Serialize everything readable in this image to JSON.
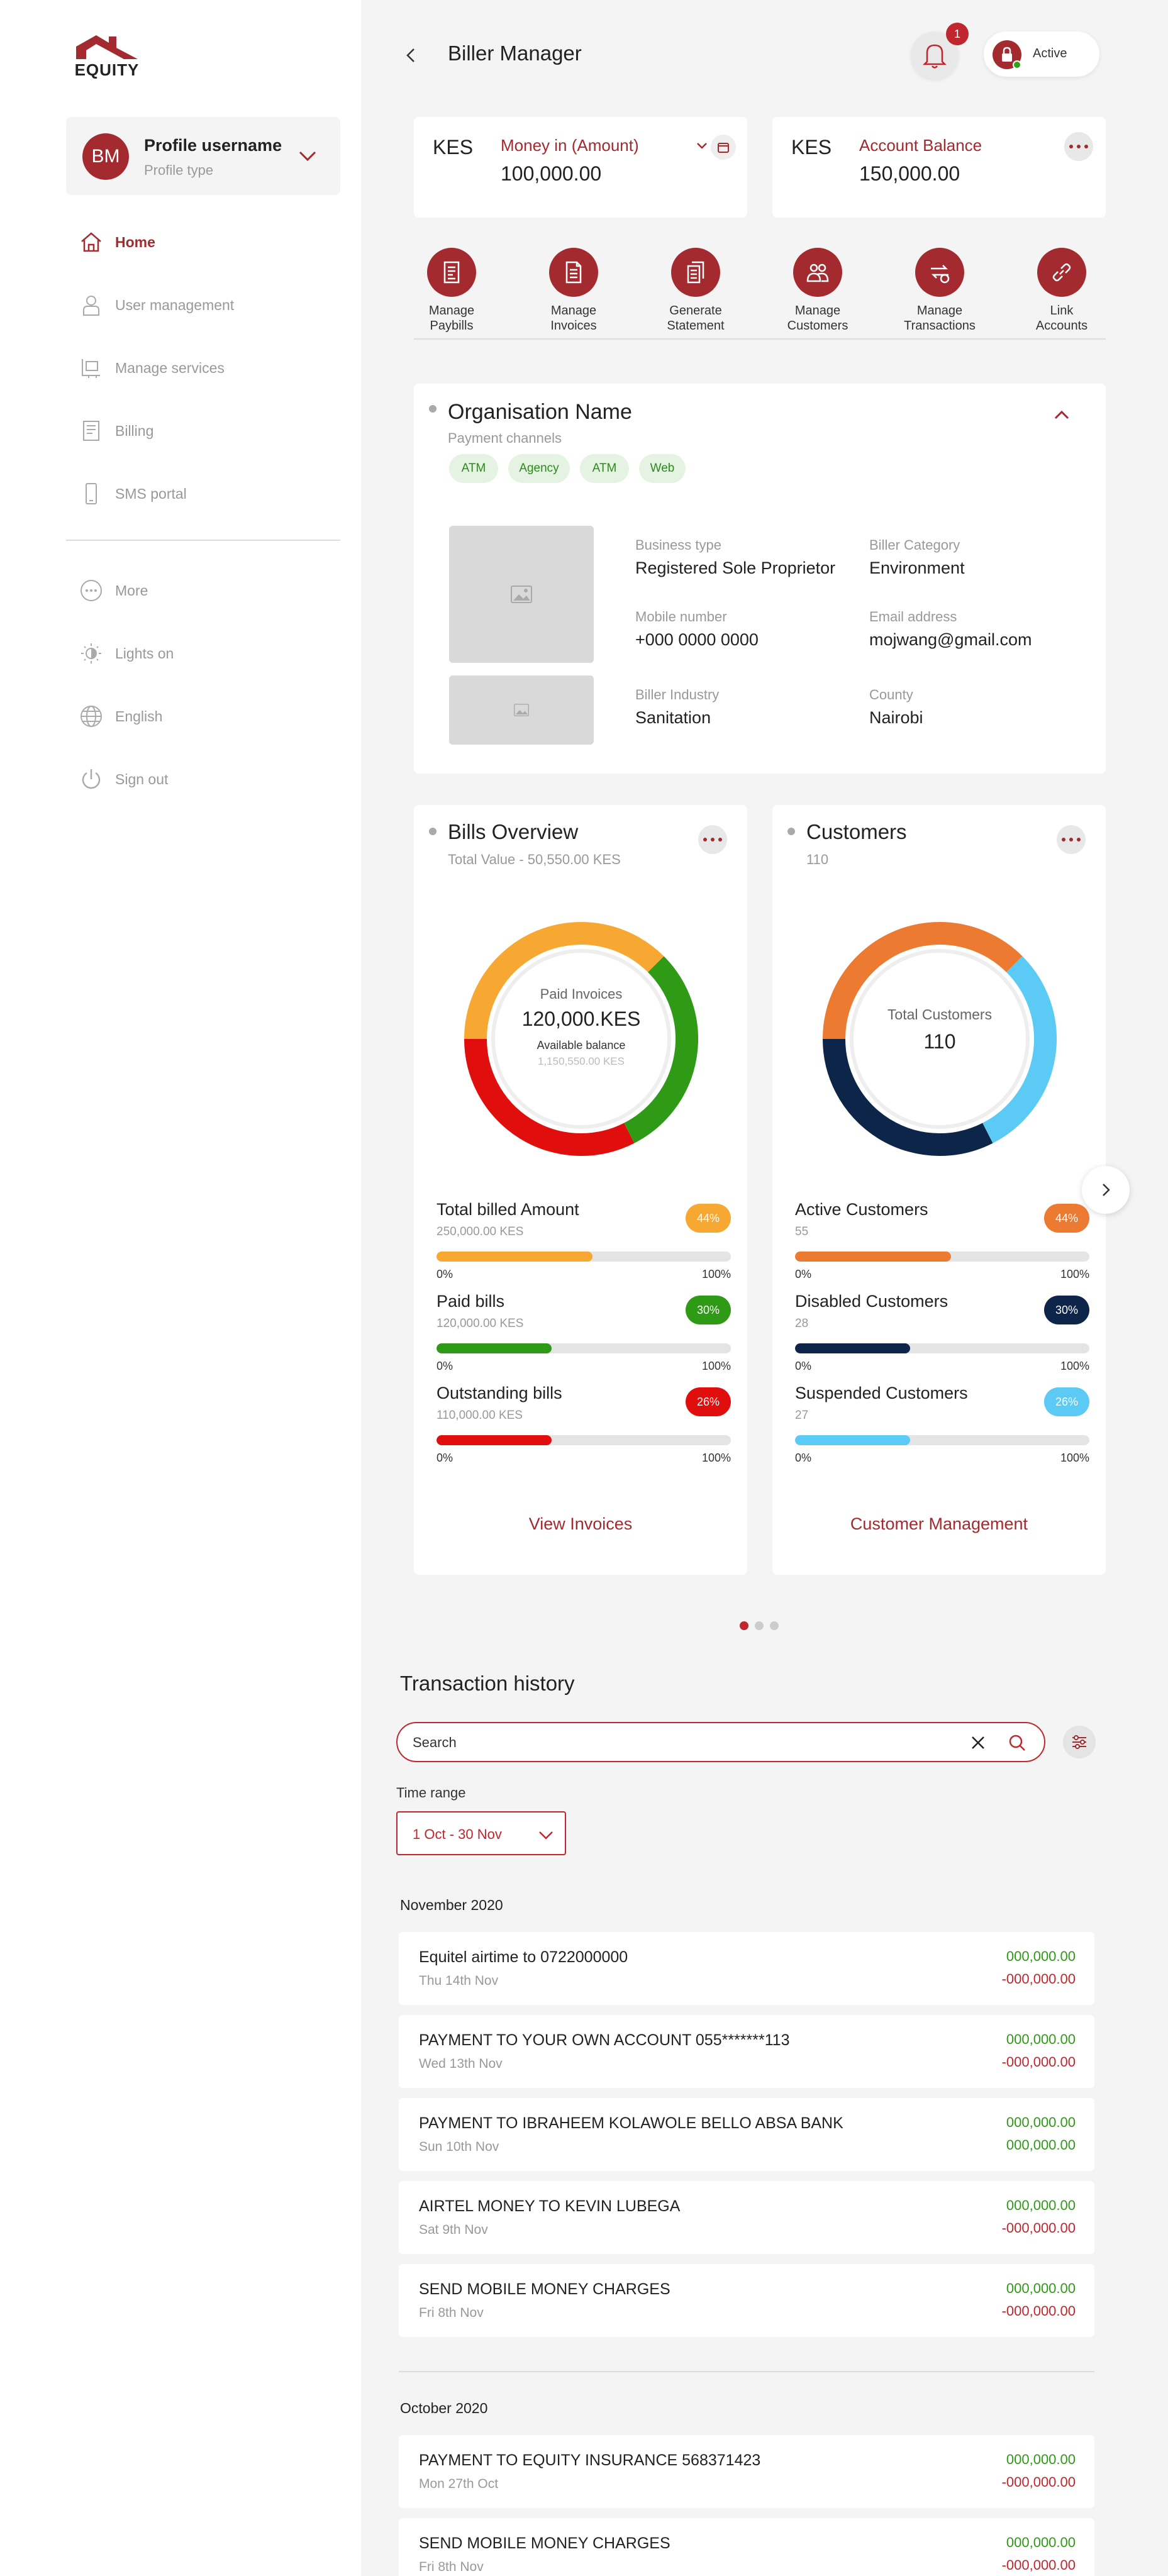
{
  "brand": {
    "name": "EQUITY",
    "accent": "#a32a2e",
    "red": "#c0262d",
    "green": "#2e9a16"
  },
  "profile": {
    "initials": "BM",
    "name": "Profile username",
    "type": "Profile type"
  },
  "nav": {
    "home": "Home",
    "users": "User management",
    "services": "Manage services",
    "billing": "Billing",
    "sms": "SMS portal",
    "more": "More",
    "lights": "Lights on",
    "language": "English",
    "signout": "Sign out"
  },
  "header": {
    "title": "Biller Manager",
    "notifications": "1",
    "status": "Active"
  },
  "money_in": {
    "currency": "KES",
    "label": "Money in (Amount)",
    "value": "100,000.00"
  },
  "balance": {
    "currency": "KES",
    "label": "Account Balance",
    "value": "150,000.00"
  },
  "quick_actions": [
    {
      "l1": "Manage",
      "l2": "Paybills"
    },
    {
      "l1": "Manage",
      "l2": "Invoices"
    },
    {
      "l1": "Generate",
      "l2": "Statement"
    },
    {
      "l1": "Manage",
      "l2": "Customers"
    },
    {
      "l1": "Manage",
      "l2": "Transactions"
    },
    {
      "l1": "Link",
      "l2": "Accounts"
    }
  ],
  "org": {
    "name": "Organisation Name",
    "sub": "Payment channels",
    "chips": [
      "ATM",
      "Agency",
      "ATM",
      "Web"
    ],
    "business_type_label": "Business type",
    "business_type": "Registered Sole Proprietor",
    "category_label": "Biller Category",
    "category": "Environment",
    "mobile_label": "Mobile number",
    "mobile": "+000 0000 0000",
    "email_label": "Email address",
    "email": "mojwang@gmail.com",
    "industry_label": "Biller Industry",
    "industry": "Sanitation",
    "county_label": "County",
    "county": "Nairobi"
  },
  "bills": {
    "title": "Bills Overview",
    "sub": "Total Value - 50,550.00 KES",
    "center_label": "Paid Invoices",
    "center_value": "120,000.KES",
    "center_label2": "Available balance",
    "center_value2": "1,150,550.00 KES",
    "donut": [
      {
        "color": "#f7a833",
        "fraction": 0.375
      },
      {
        "color": "#2e9a16",
        "fraction": 0.3
      },
      {
        "color": "#e10e0e",
        "fraction": 0.325
      }
    ],
    "stats": [
      {
        "title": "Total billed Amount",
        "sub": "250,000.00 KES",
        "pct": "44%",
        "fill": 0.53,
        "color": "#f7a833"
      },
      {
        "title": "Paid bills",
        "sub": "120,000.00 KES",
        "pct": "30%",
        "fill": 0.39,
        "color": "#2e9a16"
      },
      {
        "title": "Outstanding bills",
        "sub": "110,000.00 KES",
        "pct": "26%",
        "fill": 0.39,
        "color": "#e10e0e"
      }
    ],
    "min": "0%",
    "max": "100%",
    "link": "View Invoices"
  },
  "customers": {
    "title": "Customers",
    "sub": "110",
    "center_label": "Total Customers",
    "center_value": "110",
    "donut": [
      {
        "color": "#ec7a31",
        "fraction": 0.375
      },
      {
        "color": "#5bcbf5",
        "fraction": 0.3
      },
      {
        "color": "#0d2548",
        "fraction": 0.325
      }
    ],
    "stats": [
      {
        "title": "Active Customers",
        "sub": "55",
        "pct": "44%",
        "fill": 0.53,
        "color": "#ec7a31"
      },
      {
        "title": "Disabled Customers",
        "sub": "28",
        "pct": "30%",
        "fill": 0.39,
        "color": "#0d2548"
      },
      {
        "title": "Suspended Customers",
        "sub": "27",
        "pct": "26%",
        "fill": 0.39,
        "color": "#5bcbf5"
      }
    ],
    "min": "0%",
    "max": "100%",
    "link": "Customer Management"
  },
  "transactions": {
    "title": "Transaction history",
    "search_placeholder": "Search",
    "time_range_label": "Time range",
    "time_range_value": "1 Oct - 30 Nov",
    "months": [
      {
        "label": "November 2020",
        "items": [
          {
            "name": "Equitel airtime to 0722000000",
            "date": "Thu 14th Nov",
            "a": "000,000.00",
            "b": "-000,000.00"
          },
          {
            "name": "PAYMENT TO YOUR OWN ACCOUNT 055*******113",
            "date": "Wed 13th Nov",
            "a": "000,000.00",
            "b": "-000,000.00"
          },
          {
            "name": "PAYMENT TO IBRAHEEM KOLAWOLE BELLO ABSA BANK",
            "date": "Sun 10th Nov",
            "a": "000,000.00",
            "b": "000,000.00"
          },
          {
            "name": "AIRTEL MONEY TO KEVIN LUBEGA",
            "date": "Sat 9th Nov",
            "a": "000,000.00",
            "b": "-000,000.00"
          },
          {
            "name": "SEND MOBILE MONEY CHARGES",
            "date": "Fri 8th Nov",
            "a": "000,000.00",
            "b": "-000,000.00"
          }
        ]
      },
      {
        "label": "October 2020",
        "items": [
          {
            "name": "PAYMENT TO EQUITY INSURANCE 568371423",
            "date": "Mon 27th Oct",
            "a": "000,000.00",
            "b": "-000,000.00"
          },
          {
            "name": "SEND MOBILE MONEY CHARGES",
            "date": "Fri 8th Nov",
            "a": "000,000.00",
            "b": "-000,000.00"
          }
        ]
      }
    ]
  }
}
